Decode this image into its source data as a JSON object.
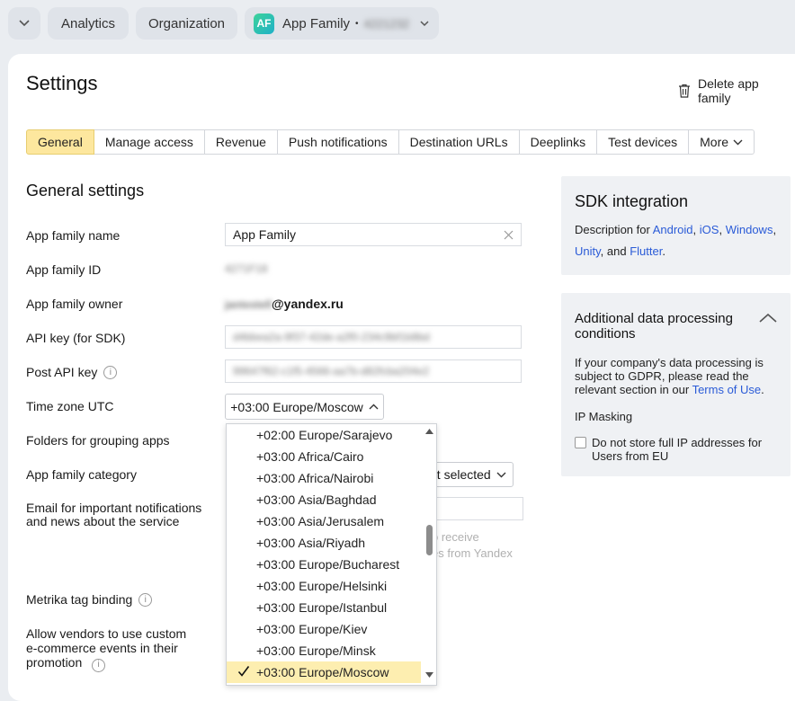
{
  "topbar": {
    "analytics": "Analytics",
    "organization": "Organization",
    "app_family_badge": "AF",
    "app_family": "App Family",
    "app_family_sep": "•",
    "app_family_id_masked": "4221232"
  },
  "page": {
    "title": "Settings",
    "delete_label": "Delete app family"
  },
  "tabs": [
    "General",
    "Manage access",
    "Revenue",
    "Push notifications",
    "Destination URLs",
    "Deeplinks",
    "Test devices",
    "More"
  ],
  "general": {
    "heading": "General settings",
    "fields": {
      "name_label": "App family name",
      "name_value": "App Family",
      "id_label": "App family ID",
      "id_value": "4271F18",
      "owner_label": "App family owner",
      "owner_masked": "jantestell",
      "owner_domain": "@yandex.ru",
      "api_key_label": "API key (for SDK)",
      "api_key_value": "d4bbea2a-9f37-42de-a2f0-234c9bf1b8bd",
      "post_api_key_label": "Post API key",
      "post_api_key_value": "99647f62-c1f5-4566-aa7b-d82fcba204e2",
      "timezone_label": "Time zone UTC",
      "timezone_value": "+03:00 Europe/Moscow",
      "folders_label": "Folders for grouping apps",
      "category_label": "App family category",
      "category_value": "ot selected",
      "email_label": "Email for important notifications and news about the service",
      "email_ghost_1": "o receive",
      "email_ghost_2": "es from Yandex",
      "metrika_label": "Metrika tag binding",
      "vendors_label": "Allow vendors to use custom e-commerce events in their promotion"
    }
  },
  "timezone_dropdown": {
    "options": [
      "+02:00 Europe/Sarajevo",
      "+03:00 Africa/Cairo",
      "+03:00 Africa/Nairobi",
      "+03:00 Asia/Baghdad",
      "+03:00 Asia/Jerusalem",
      "+03:00 Asia/Riyadh",
      "+03:00 Europe/Bucharest",
      "+03:00 Europe/Helsinki",
      "+03:00 Europe/Istanbul",
      "+03:00 Europe/Kiev",
      "+03:00 Europe/Minsk",
      "+03:00 Europe/Moscow"
    ],
    "selected_index": 11
  },
  "sdk": {
    "title": "SDK integration",
    "desc_prefix": "Description for",
    "android": "Android",
    "comma": ",",
    "ios": "iOS",
    "windows": "Windows",
    "unity": "Unity",
    "and": ", and",
    "flutter": "Flutter",
    "period": "."
  },
  "data_processing": {
    "title": "Additional data processing conditions",
    "text": "If your company's data processing is subject to GDPR, please read the relevant section in our",
    "terms_link": "Terms of Use",
    "period": ".",
    "ip_masking": "IP Masking",
    "checkbox_label": "Do not store full IP addresses for Users from EU"
  },
  "colors": {
    "accent_tab": "#fde79e",
    "link": "#2a5bd7",
    "background": "#eaedf1"
  }
}
